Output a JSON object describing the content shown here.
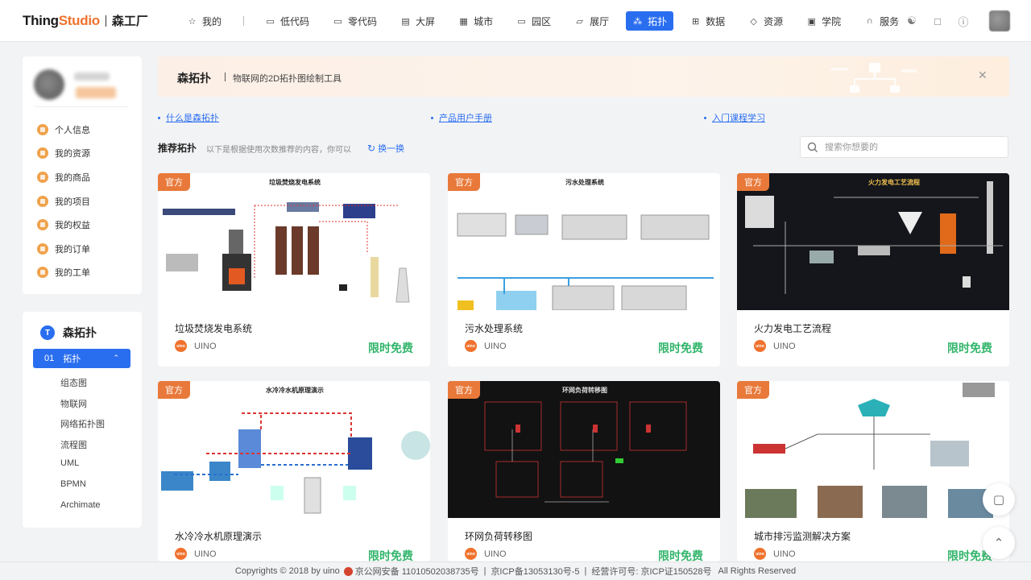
{
  "brand": {
    "name_part1": "Thing",
    "name_part2": "Studio",
    "sub": "森工厂"
  },
  "nav": [
    {
      "label": "我的",
      "icon": "star-icon",
      "glyph": "☆"
    },
    {
      "label": "低代码",
      "icon": "code-window-icon",
      "glyph": "▭"
    },
    {
      "label": "零代码",
      "icon": "edit-window-icon",
      "glyph": "▭"
    },
    {
      "label": "大屏",
      "icon": "screen-icon",
      "glyph": "▤"
    },
    {
      "label": "城市",
      "icon": "city-icon",
      "glyph": "▦"
    },
    {
      "label": "园区",
      "icon": "park-icon",
      "glyph": "▭"
    },
    {
      "label": "展厅",
      "icon": "hall-icon",
      "glyph": "▱"
    },
    {
      "label": "拓扑",
      "icon": "topology-icon",
      "glyph": "⁂"
    },
    {
      "label": "数据",
      "icon": "data-icon",
      "glyph": "⊞"
    },
    {
      "label": "资源",
      "icon": "diamond-icon",
      "glyph": "◇"
    },
    {
      "label": "学院",
      "icon": "book-icon",
      "glyph": "▣"
    },
    {
      "label": "服务",
      "icon": "headset-icon",
      "glyph": "∩"
    }
  ],
  "nav_active": "拓扑",
  "top_icons": [
    "accessibility-icon",
    "message-icon",
    "help-icon"
  ],
  "profile_menu": [
    "个人信息",
    "我的资源",
    "我的商品",
    "我的项目",
    "我的权益",
    "我的订单",
    "我的工单"
  ],
  "topo_panel": {
    "logo": "T",
    "title": "森拓扑",
    "active_num": "01",
    "active_label": "拓扑",
    "sub_items": [
      "组态图",
      "物联网",
      "网络拓扑图",
      "流程图",
      "UML",
      "BPMN",
      "Archimate"
    ]
  },
  "banner": {
    "title": "森拓扑",
    "desc": "物联网的2D拓扑图绘制工具"
  },
  "links": [
    "什么是森拓扑",
    "产品用户手册",
    "入门课程学习"
  ],
  "recommend": {
    "title": "推荐拓扑",
    "desc": "以下是根据使用次数推荐的内容，你可以",
    "swap": "换一换",
    "search_placeholder": "搜索你想要的"
  },
  "cards": [
    {
      "name": "垃圾焚烧发电系统",
      "badge": "官方",
      "vendor": "UINO",
      "price": "限时免费",
      "thumb_title": "垃圾焚烧发电系统"
    },
    {
      "name": "污水处理系统",
      "badge": "官方",
      "vendor": "UINO",
      "price": "限时免费",
      "thumb_title": "污水处理系统"
    },
    {
      "name": "火力发电工艺流程",
      "badge": "官方",
      "vendor": "UINO",
      "price": "限时免费",
      "thumb_title": "火力发电工艺流程"
    },
    {
      "name": "水冷冷水机原理演示",
      "badge": "官方",
      "vendor": "UINO",
      "price": "限时免费",
      "thumb_title": "水冷冷水机原理演示"
    },
    {
      "name": "环网负荷转移图",
      "badge": "官方",
      "vendor": "UINO",
      "price": "限时免费",
      "thumb_title": "环网负荷转移图"
    },
    {
      "name": "城市排污监测解决方案",
      "badge": "官方",
      "vendor": "UINO",
      "price": "限时免费",
      "thumb_title": ""
    }
  ],
  "footer": {
    "copyright": "Copyrights © 2018 by uino",
    "police": "京公网安备 11010502038735号",
    "icp": "京ICP备13053130号-5",
    "license": "经营许可号: 京ICP证150528号",
    "rights": "All Rights Reserved"
  },
  "colors": {
    "primary": "#2a6ef0",
    "accent": "#f0712c",
    "free_green": "#32b56b",
    "badge": "#e8793a"
  }
}
